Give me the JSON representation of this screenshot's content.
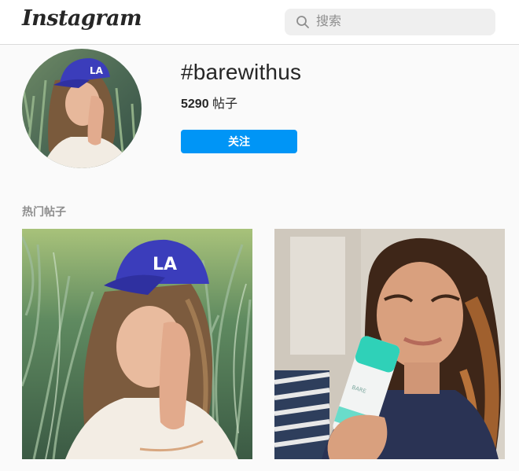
{
  "header": {
    "logo_text": "Instagram",
    "search_placeholder": "搜索",
    "search_icon": "search-icon"
  },
  "profile": {
    "hashtag": "#barewithus",
    "post_count_value": "5290",
    "post_count_unit": " 帖子",
    "follow_label": "关注"
  },
  "section": {
    "top_posts_label": "热门帖子"
  },
  "colors": {
    "accent": "#0095f6",
    "cap_blue": "#3b3dbb",
    "bottle_teal": "#2fd1b8"
  }
}
